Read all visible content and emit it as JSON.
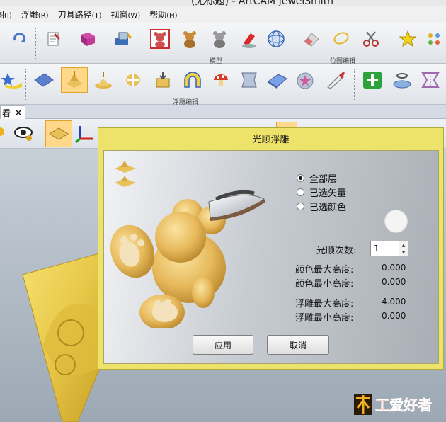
{
  "window": {
    "title": "(无标题) - ArtCAM JewelSmith"
  },
  "menubar": {
    "items": [
      {
        "label": "图",
        "key": "(I)"
      },
      {
        "label": "浮雕",
        "key": "(R)"
      },
      {
        "label": "刀具路径",
        "key": "(T)"
      },
      {
        "label": "视窗",
        "key": "(W)"
      },
      {
        "label": "帮助",
        "key": "(H)"
      }
    ]
  },
  "toolbar1": {
    "group_model_label": "模型",
    "group_bitmap_label": "位图编辑",
    "icons": [
      "redo-icon",
      "note-icon",
      "book-icon",
      "import-icon",
      "bear-bitmap-icon",
      "bear-model-icon",
      "bear-gray-icon",
      "pen-relief-icon",
      "sphere-mesh-icon",
      "eraser-icon",
      "lasso-icon",
      "scissors-icon",
      "wand-icon",
      "dots-icon"
    ]
  },
  "toolbar2": {
    "group_relief_label": "浮雕编辑",
    "icons": [
      "star-icon",
      "plane-icon",
      "smooth-relief-icon",
      "relief-spray-icon",
      "relief-move-icon",
      "relief-offset-icon",
      "arch-icon",
      "mushroom-icon",
      "relief-frame-icon",
      "relief-tilt-icon",
      "star-disc-icon",
      "relief-knife-icon",
      "add-relief-icon",
      "relief-rotate-icon",
      "relief-mirror-icon"
    ]
  },
  "tabstrip": {
    "tab_label": "看",
    "close": "×"
  },
  "colors": {
    "dialog_frame": "#ede36a",
    "relief_gold": "#e8c15a",
    "active_tool": "#ffd88a"
  },
  "dialog": {
    "title": "光顺浮雕",
    "options": [
      {
        "label": "全部层",
        "checked": true
      },
      {
        "label": "已选矢量",
        "checked": false
      },
      {
        "label": "已选颜色",
        "checked": false
      }
    ],
    "smooth_count_label": "光顺次数:",
    "smooth_count_value": "1",
    "stats": [
      {
        "label": "颜色最大高度:",
        "value": "0.000"
      },
      {
        "label": "颜色最小高度:",
        "value": "0.000"
      },
      {
        "label": "浮雕最大高度:",
        "value": "4.000"
      },
      {
        "label": "浮雕最小高度:",
        "value": "0.000"
      }
    ],
    "apply_label": "应用",
    "cancel_label": "取消"
  },
  "watermark": {
    "text": "木工爱好者"
  }
}
